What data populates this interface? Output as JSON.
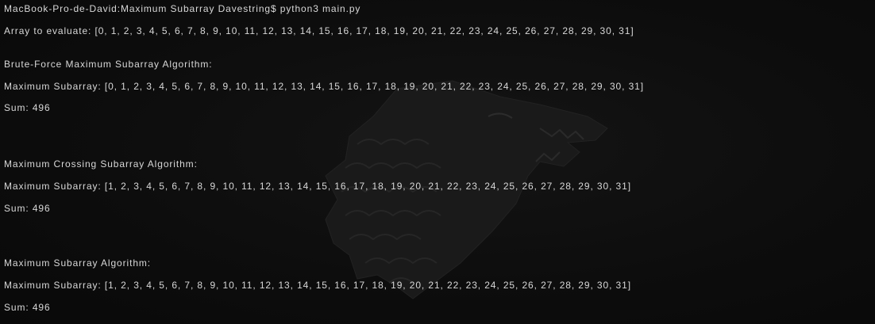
{
  "terminal": {
    "prompt_line": "MacBook-Pro-de-David:Maximum Subarray Davestring$ python3 main.py",
    "array_line": "Array to evaluate: [0, 1, 2, 3, 4, 5, 6, 7, 8, 9, 10, 11, 12, 13, 14, 15, 16, 17, 18, 19, 20, 21, 22, 23, 24, 25, 26, 27, 28, 29, 30, 31]",
    "sections": [
      {
        "heading": "Brute-Force Maximum Subarray Algorithm:",
        "result": "Maximum Subarray: [0, 1, 2, 3, 4, 5, 6, 7, 8, 9, 10, 11, 12, 13, 14, 15, 16, 17, 18, 19, 20, 21, 22, 23, 24, 25, 26, 27, 28, 29, 30, 31]",
        "sum": "Sum: 496"
      },
      {
        "heading": "Maximum Crossing Subarray Algorithm:",
        "result": "Maximum Subarray: [1, 2, 3, 4, 5, 6, 7, 8, 9, 10, 11, 12, 13, 14, 15, 16, 17, 18, 19, 20, 21, 22, 23, 24, 25, 26, 27, 28, 29, 30, 31]",
        "sum": "Sum: 496"
      },
      {
        "heading": "Maximum Subarray Algorithm:",
        "result": "Maximum Subarray: [1, 2, 3, 4, 5, 6, 7, 8, 9, 10, 11, 12, 13, 14, 15, 16, 17, 18, 19, 20, 21, 22, 23, 24, 25, 26, 27, 28, 29, 30, 31]",
        "sum": "Sum: 496"
      }
    ]
  },
  "background": {
    "icon": "wolf-sigil-icon",
    "color": "#1c1c1c"
  }
}
